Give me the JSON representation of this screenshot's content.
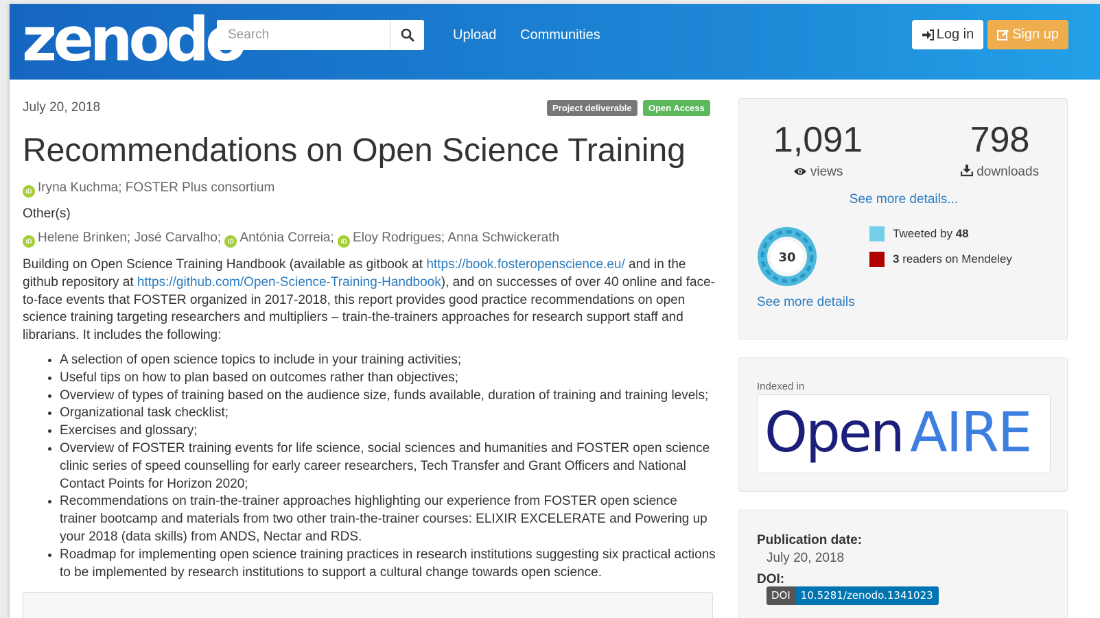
{
  "header": {
    "logo": "zenodo",
    "search_placeholder": "Search",
    "nav": [
      "Upload",
      "Communities"
    ],
    "login_label": "Log in",
    "signup_label": "Sign up"
  },
  "record": {
    "date": "July 20, 2018",
    "badges": {
      "type": "Project deliverable",
      "access": "Open Access"
    },
    "title": "Recommendations on Open Science Training",
    "creators": "Iryna Kuchma; FOSTER Plus consortium",
    "others_label": "Other(s)",
    "contributors": {
      "c1": "Helene Brinken; José Carvalho;",
      "c2": "Antónia Correia;",
      "c3": "Eloy Rodrigues; Anna Schwickerath"
    },
    "description": {
      "p1": "Building on Open Science Training Handbook (available as gitbook at ",
      "link1": "https://book.fosteropenscience.eu/",
      "p2": " and in the github repository at ",
      "link2": "https://github.com/Open-Science-Training-Handbook",
      "p3": "), and on successes of over 40 online and face-to-face events that FOSTER organized in 2017-2018, this report provides good practice recommendations on open science training targeting researchers and multipliers – train-the-trainers approaches for research support staff and librarians. It includes the following:",
      "bullets": [
        "A selection of open science topics to include in your training activities;",
        "Useful tips on how to plan based on outcomes rather than objectives;",
        "Overview of types of training based on the audience size, funds available, duration of training and training levels;",
        "Organizational task checklist;",
        "Exercises and glossary;",
        "Overview of FOSTER training events for life science, social sciences and humanities and FOSTER open science clinic series of speed counselling for early career researchers, Tech Transfer and Grant Officers and National Contact Points for Horizon 2020;",
        "Recommendations on train-the-trainer approaches highlighting our experience from FOSTER open science trainer bootcamp and materials from two other train-the-trainer courses: ELIXIR EXCELERATE and Powering up your 2018 (data skills) from ANDS, Nectar and RDS.",
        "Roadmap for implementing open science training practices in research institutions suggesting six practical actions to be implemented by research institutions to support a cultural change towards open science."
      ]
    }
  },
  "sidebar": {
    "stats": {
      "views": "1,091",
      "views_label": "views",
      "downloads": "798",
      "downloads_label": "downloads",
      "details_link": "See more details..."
    },
    "altmetric": {
      "score": "30",
      "tweet_prefix": "Tweeted by",
      "tweet_count": "48",
      "mendeley_count": "3",
      "mendeley_suffix": "readers on Mendeley",
      "details_link": "See more details",
      "tweet_color": "#74cfe8",
      "mendeley_color": "#b00000"
    },
    "indexed": {
      "label": "Indexed in",
      "logo_open": "Open",
      "logo_aire": "AIRE"
    },
    "publication": {
      "date_label": "Publication date:",
      "date_value": "July 20, 2018",
      "doi_label": "DOI:",
      "doi_prefix": "DOI",
      "doi_value": "10.5281/zenodo.1341023"
    }
  }
}
